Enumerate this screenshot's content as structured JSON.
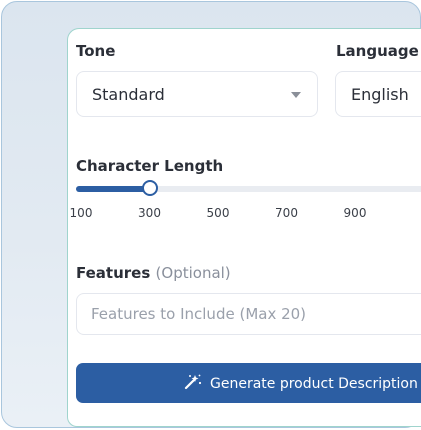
{
  "tone": {
    "label": "Tone",
    "value": "Standard"
  },
  "language": {
    "label": "Language",
    "value": "English"
  },
  "character_length": {
    "label": "Character Length",
    "ticks": [
      "100",
      "300",
      "500",
      "700",
      "900"
    ],
    "min": 100,
    "max": 1100,
    "value": 300
  },
  "features": {
    "label": "Features",
    "optional": "(Optional)",
    "placeholder": "Features to Include (Max 20)"
  },
  "generate_button": {
    "label": "Generate product Description",
    "icon": "magic-wand-icon"
  },
  "colors": {
    "primary": "#2c5ea3",
    "border": "#e4e7ee",
    "teal_border": "#9fd4cd"
  }
}
